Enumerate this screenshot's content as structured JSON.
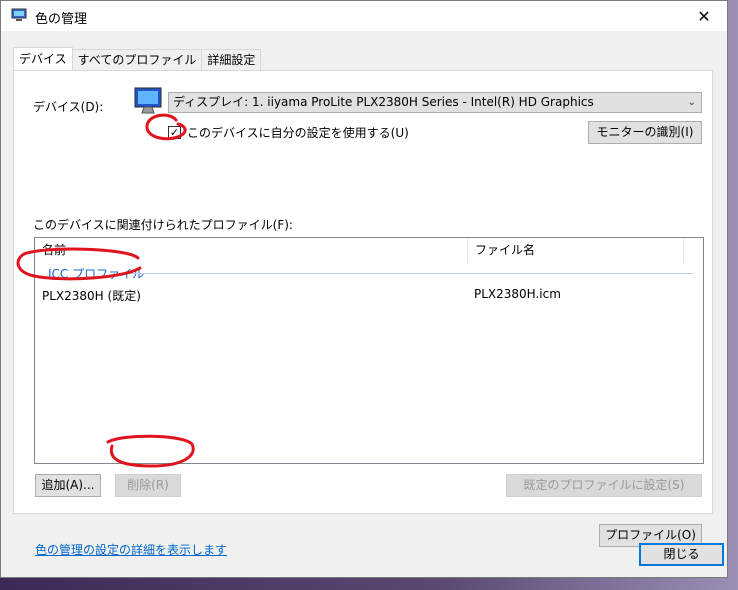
{
  "window": {
    "title": "色の管理",
    "close_glyph": "✕"
  },
  "tabs": [
    {
      "label": "デバイス",
      "active": true
    },
    {
      "label": "すべてのプロファイル",
      "active": false
    },
    {
      "label": "詳細設定",
      "active": false
    }
  ],
  "device": {
    "label": "デバイス(D):",
    "selected": "ディスプレイ: 1. iiyama ProLite PLX2380H Series - Intel(R) HD Graphics",
    "use_my_settings_label": "このデバイスに自分の設定を使用する(U)",
    "use_my_settings_checked": true,
    "identify_button": "モニターの識別(I)"
  },
  "profiles": {
    "label": "このデバイスに関連付けられたプロファイル(F):",
    "columns": [
      "名前",
      "ファイル名"
    ],
    "group": "ICC プロファイル",
    "rows": [
      {
        "name": "PLX2380H (既定)",
        "file": "PLX2380H.icm"
      }
    ]
  },
  "buttons": {
    "add": "追加(A)...",
    "remove": "削除(R)",
    "set_default": "既定のプロファイルに設定(S)",
    "profile": "プロファイル(O)",
    "close": "閉じる"
  },
  "link_text": "色の管理の設定の詳細を表示します",
  "colors": {
    "annotation": "#e0141e",
    "link": "#0066cc",
    "group": "#1e64c8"
  }
}
